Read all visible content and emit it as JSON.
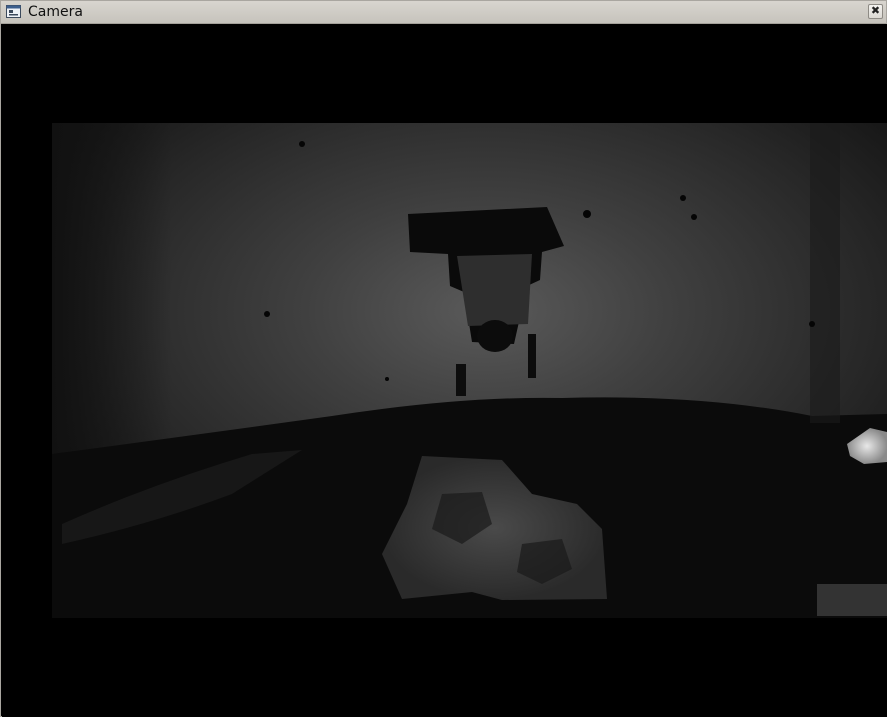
{
  "window": {
    "title": "Camera",
    "close_glyph": "✖",
    "app_icon": "window-app-icon",
    "close_icon": "close-icon"
  },
  "camera_view": {
    "mode": "depth-grayscale",
    "background_color": "#000000"
  }
}
